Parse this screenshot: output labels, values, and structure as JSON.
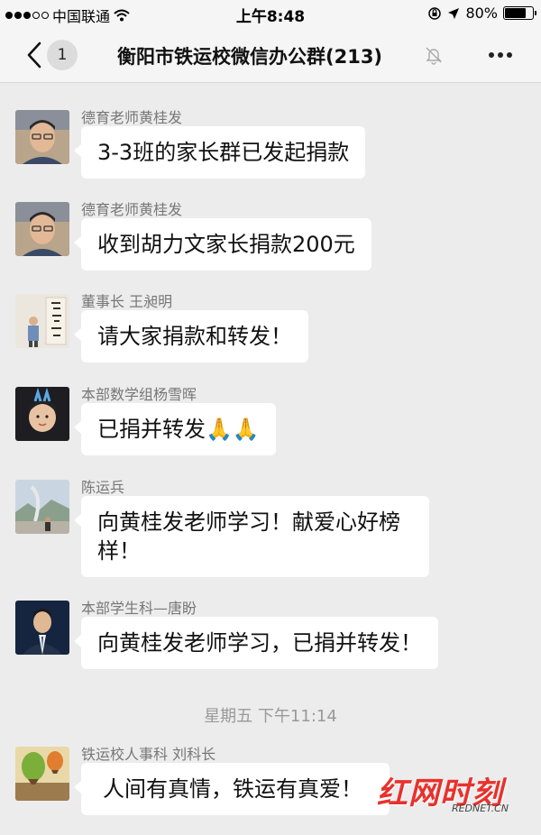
{
  "status_bar": {
    "carrier": "中国联通",
    "time": "上午8:48",
    "battery": "80%",
    "battery_level": 0.8
  },
  "nav": {
    "back_badge": "1",
    "title": "衡阳市铁运校微信办公群(213)"
  },
  "messages": [
    {
      "sender": "德育老师黄桂发",
      "text": "3-3班的家长群已发起捐款",
      "avatar_icon": "avatar-man-glasses"
    },
    {
      "sender": "德育老师黄桂发",
      "text": "收到胡力文家长捐款200元",
      "avatar_icon": "avatar-man-glasses"
    },
    {
      "sender": "董事长 王昶明",
      "text": "请大家捐款和转发！",
      "avatar_icon": "avatar-calligraphy"
    },
    {
      "sender": "本部数学组杨雪晖",
      "text": "已捐并转发🙏🙏",
      "avatar_icon": "avatar-child"
    },
    {
      "sender": "陈运兵",
      "text": "向黄桂发老师学习！献爱心好榜样！",
      "avatar_icon": "avatar-landscape"
    },
    {
      "sender": "本部学生科—唐盼",
      "text": "向黄桂发老师学习，已捐并转发！",
      "avatar_icon": "avatar-man-suit"
    },
    {
      "sender": "铁运校人事科 刘科长",
      "text": "人间有真情，铁运有真爱！",
      "avatar_icon": "avatar-balloon"
    }
  ],
  "timestamp": "星期五 下午11:14",
  "watermark": {
    "main": "红网时刻",
    "sub": "REDNET.CN"
  }
}
